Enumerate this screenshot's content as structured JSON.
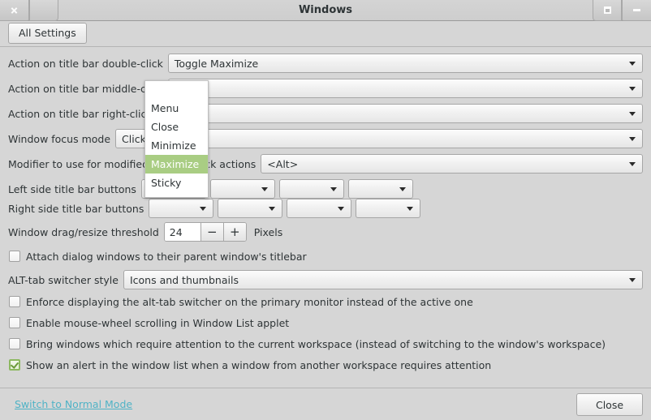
{
  "window": {
    "title": "Windows",
    "buttons": {
      "close": "close-icon",
      "menu": "window-menu-icon",
      "maximize": "maximize-icon",
      "minimize": "minimize-icon"
    }
  },
  "toolbar": {
    "all_settings_label": "All Settings"
  },
  "settings": {
    "rows": [
      {
        "label": "Action on title bar double-click",
        "value": "Toggle Maximize"
      },
      {
        "label": "Action on title bar middle-click",
        "value": ""
      },
      {
        "label": "Action on title bar right-click",
        "value": ""
      },
      {
        "label": "Window focus mode",
        "value": "Click"
      },
      {
        "label": "Modifier to use for modified window click actions",
        "value": "<Alt>"
      }
    ],
    "left_side_buttons": {
      "label": "Left side title bar buttons",
      "slots": [
        "",
        "",
        "",
        ""
      ]
    },
    "right_side_buttons": {
      "label": "Right side title bar buttons",
      "slots": [
        "",
        "",
        "",
        ""
      ]
    },
    "threshold": {
      "label": "Window drag/resize threshold",
      "value": "24",
      "decrement": "−",
      "increment": "+",
      "suffix": "Pixels"
    },
    "attach_dialogs": {
      "label": "Attach dialog windows to their parent window's titlebar",
      "checked": false
    },
    "alt_tab": {
      "label": "ALT-tab switcher style",
      "value": "Icons and thumbnails"
    },
    "checkboxes": [
      {
        "label": "Enforce displaying the alt-tab switcher on the primary monitor instead of the active one",
        "checked": false
      },
      {
        "label": "Enable mouse-wheel scrolling in Window List applet",
        "checked": false
      },
      {
        "label": "Bring windows which require attention to the current workspace (instead of switching to the window's workspace)",
        "checked": false
      },
      {
        "label": "Show an alert in the window list when a window from another workspace requires attention",
        "checked": true
      }
    ]
  },
  "popup": {
    "items": [
      "Menu",
      "Close",
      "Minimize",
      "Maximize",
      "Sticky"
    ],
    "selected_index": 3,
    "highlight_color": "#a9cd83"
  },
  "footer": {
    "mode_link": "Switch to Normal Mode",
    "close_label": "Close",
    "link_color": "#4fb3c6"
  }
}
